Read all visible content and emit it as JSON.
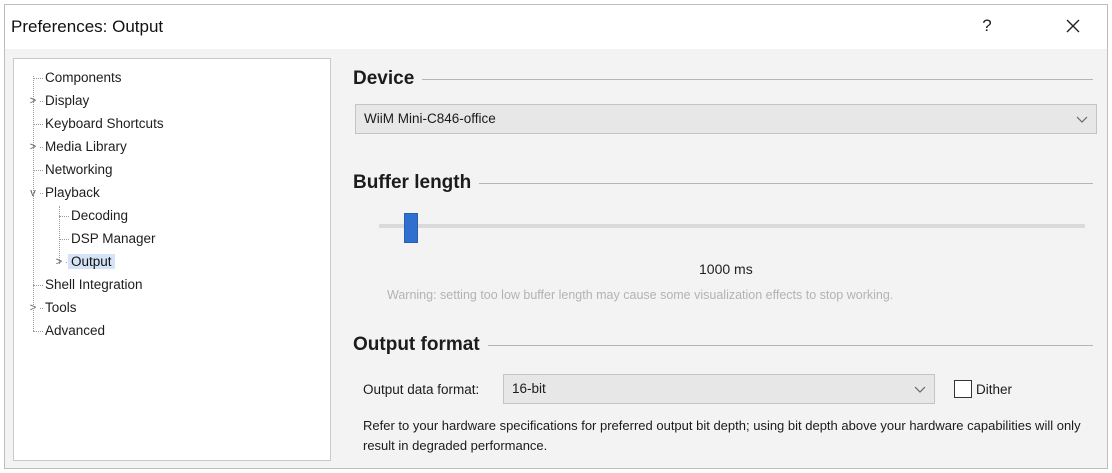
{
  "window": {
    "title": "Preferences: Output",
    "help_glyph": "?",
    "close_icon": "close-icon"
  },
  "tree": {
    "items": [
      {
        "label": "Components",
        "level": 0,
        "expandable": false,
        "expanded": false,
        "selected": false
      },
      {
        "label": "Display",
        "level": 0,
        "expandable": true,
        "expanded": false,
        "selected": false
      },
      {
        "label": "Keyboard Shortcuts",
        "level": 0,
        "expandable": false,
        "expanded": false,
        "selected": false
      },
      {
        "label": "Media Library",
        "level": 0,
        "expandable": true,
        "expanded": false,
        "selected": false
      },
      {
        "label": "Networking",
        "level": 0,
        "expandable": false,
        "expanded": false,
        "selected": false
      },
      {
        "label": "Playback",
        "level": 0,
        "expandable": true,
        "expanded": true,
        "selected": false
      },
      {
        "label": "Decoding",
        "level": 1,
        "expandable": false,
        "expanded": false,
        "selected": false
      },
      {
        "label": "DSP Manager",
        "level": 1,
        "expandable": false,
        "expanded": false,
        "selected": false
      },
      {
        "label": "Output",
        "level": 1,
        "expandable": true,
        "expanded": false,
        "selected": true
      },
      {
        "label": "Shell Integration",
        "level": 0,
        "expandable": false,
        "expanded": false,
        "selected": false
      },
      {
        "label": "Tools",
        "level": 0,
        "expandable": true,
        "expanded": false,
        "selected": false
      },
      {
        "label": "Advanced",
        "level": 0,
        "expandable": false,
        "expanded": false,
        "selected": false
      }
    ],
    "expand_collapsed_glyph": ">",
    "expand_expanded_glyph": "v"
  },
  "device": {
    "heading": "Device",
    "selected": "WiiM Mini-C846-office"
  },
  "buffer": {
    "heading": "Buffer length",
    "value_text": "1000 ms",
    "slider_fraction": 0.035,
    "warning": "Warning: setting too low buffer length may cause some visualization effects to stop working."
  },
  "output_format": {
    "heading": "Output format",
    "field_label": "Output data format:",
    "selected": "16-bit",
    "dither_label": "Dither",
    "dither_checked": false,
    "note": "Refer to your hardware specifications for preferred output bit depth; using bit depth above your hardware capabilities will only result in degraded performance."
  },
  "colors": {
    "accent": "#2f6fcf",
    "selection": "#d4e3f5"
  }
}
